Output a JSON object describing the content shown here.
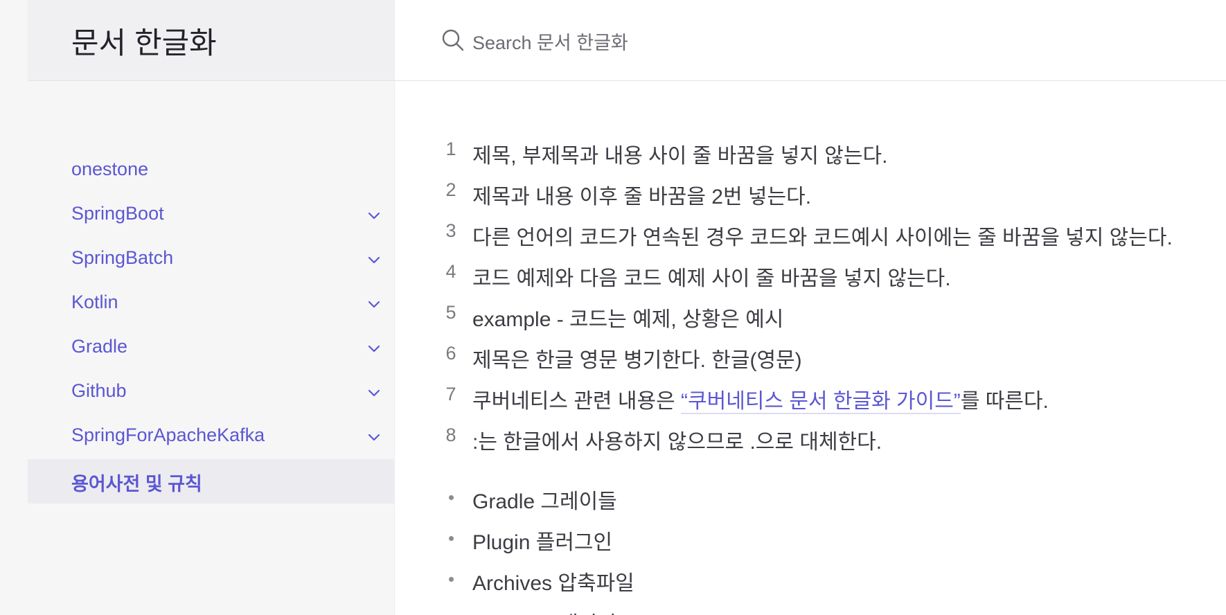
{
  "site": {
    "title": "문서 한글화"
  },
  "search": {
    "placeholder": "Search 문서 한글화",
    "icon": "search-icon"
  },
  "sidebar": {
    "items": [
      {
        "label": "onestone",
        "expandable": false,
        "active": false
      },
      {
        "label": "SpringBoot",
        "expandable": true,
        "active": false
      },
      {
        "label": "SpringBatch",
        "expandable": true,
        "active": false
      },
      {
        "label": "Kotlin",
        "expandable": true,
        "active": false
      },
      {
        "label": "Gradle",
        "expandable": true,
        "active": false
      },
      {
        "label": "Github",
        "expandable": true,
        "active": false
      },
      {
        "label": "SpringForApacheKafka",
        "expandable": true,
        "active": false
      },
      {
        "label": "용어사전 및 규칙",
        "expandable": false,
        "active": true
      }
    ]
  },
  "content": {
    "rules": [
      {
        "num": "1",
        "text": "제목, 부제목과 내용 사이 줄 바꿈을 넣지 않는다."
      },
      {
        "num": "2",
        "text": "제목과 내용 이후 줄 바꿈을 2번 넣는다."
      },
      {
        "num": "3",
        "text": "다른 언어의 코드가 연속된 경우 코드와 코드예시 사이에는 줄 바꿈을 넣지 않는다."
      },
      {
        "num": "4",
        "text": "코드 예제와 다음 코드 예제 사이 줄 바꿈을 넣지 않는다."
      },
      {
        "num": "5",
        "text": "example - 코드는 예제, 상황은 예시"
      },
      {
        "num": "6",
        "text": "제목은 한글 영문 병기한다. 한글(영문)"
      },
      {
        "num": "7",
        "text_before": "쿠버네티스 관련 내용은 ",
        "link": "“쿠버네티스 문서 한글화 가이드”",
        "text_after": "를 따른다."
      },
      {
        "num": "8",
        "text": ":는 한글에서 사용하지 않으므로 .으로 대체한다."
      }
    ],
    "glossary": [
      {
        "text": "Gradle 그레이들"
      },
      {
        "text": "Plugin 플러그인"
      },
      {
        "text": "Archives 압축파일"
      },
      {
        "text": "Package 패키지"
      }
    ]
  },
  "colors": {
    "accent": "#5b57d1",
    "sidebar_bg": "#f6f6f7",
    "text": "#3c3c43"
  }
}
